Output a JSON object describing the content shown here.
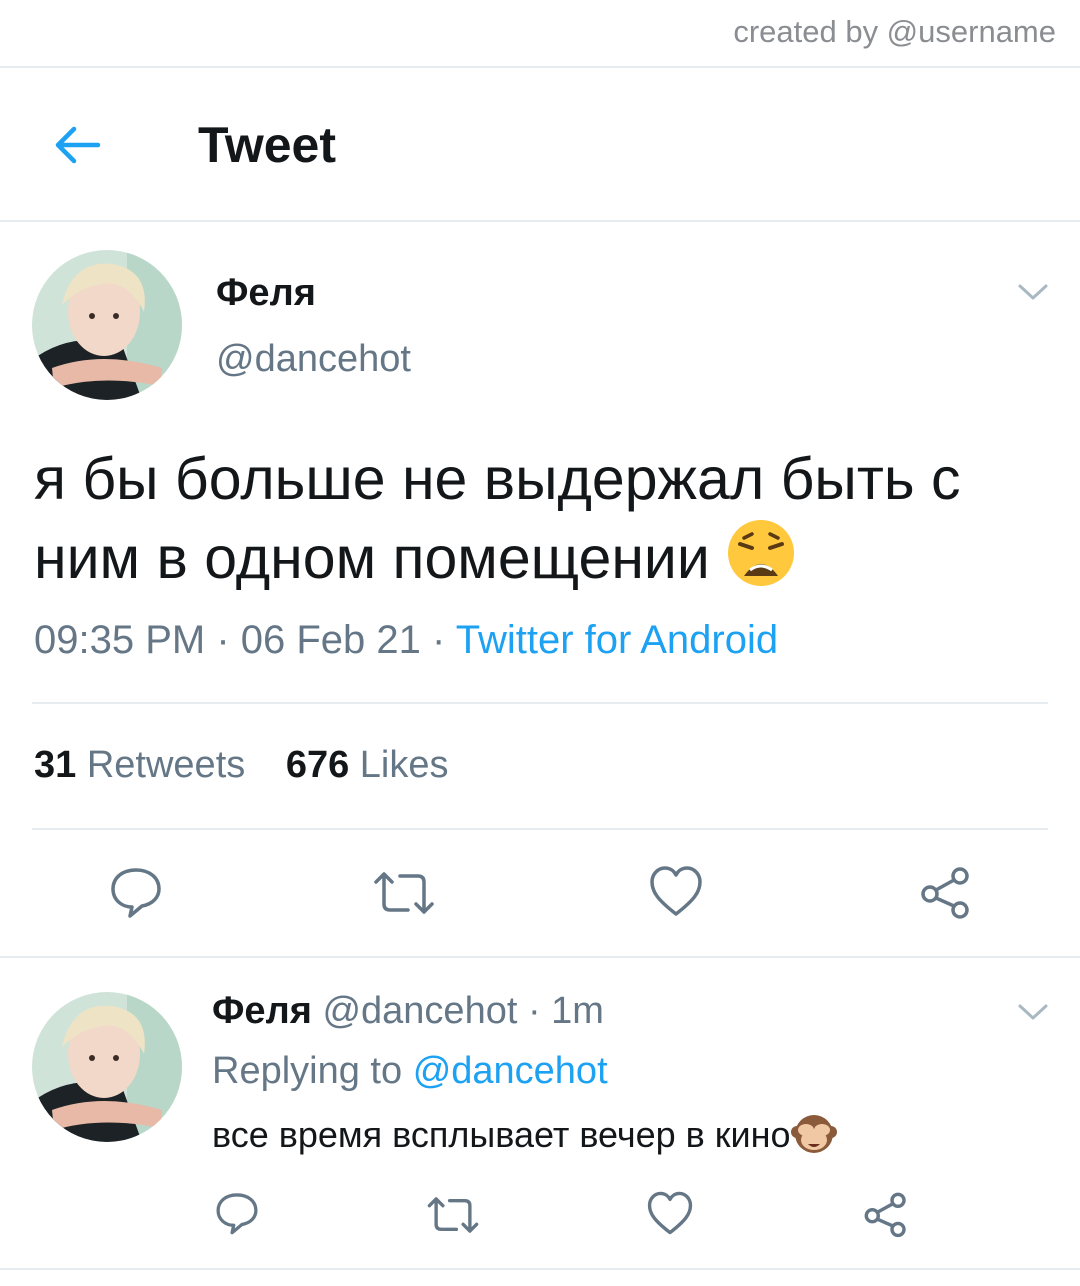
{
  "watermark": "created by @username",
  "header": {
    "title": "Tweet",
    "back_icon": "arrow-left-icon"
  },
  "tweet": {
    "author_name": "Феля",
    "handle": "@dancehot",
    "text_line1": "я бы больше не выдержал быть с",
    "text_line2": "ним в одном помещении",
    "emoji": "weary-face",
    "time": "09:35 PM",
    "date": "06 Feb 21",
    "sep": " · ",
    "source": "Twitter for Android",
    "retweets_count": "31",
    "retweets_label": "Retweets",
    "likes_count": "676",
    "likes_label": "Likes"
  },
  "reply": {
    "author_name": "Феля",
    "handle": "@dancehot",
    "time": "1m",
    "replying_prefix": "Replying to",
    "replying_to": "@dancehot",
    "text": "все время всплывает вечер в кино",
    "emoji": "see-no-evil-monkey"
  },
  "colors": {
    "accent": "#1da1f2",
    "muted": "#657786",
    "text": "#14171a",
    "divider": "#e6ecf0",
    "icon": "#657786"
  }
}
